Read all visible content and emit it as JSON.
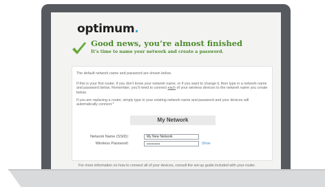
{
  "brand": {
    "name": "optimum",
    "dot": ".",
    "dot_color": "#3fa4d8"
  },
  "header": {
    "headline": "Good news, you’re almost finished",
    "subhead": "It’s time to name your network and create a password.",
    "accent": "#4e8a2e"
  },
  "intro": {
    "p1": "The default network name and password are shown below.",
    "p2_before": "If this is your first router, if you don’t know your network name, or if you want to change it, then type in a network name and password below. Remember, you’ll need to connect ",
    "p2_underlined": "each",
    "p2_after": " of your wireless devices to the network name you create below.",
    "p3": "If you are replacing a router, simply type in your existing network name and password and your devices will automatically connect.*"
  },
  "network_form": {
    "title": "My Network",
    "ssid_label": "Network Name (SSID):",
    "ssid_value": "My New Network",
    "password_label": "Wireless Password:",
    "password_value": "••••••••••",
    "show_label": "Show"
  },
  "footer": {
    "note": "For more information on how to connect all of your devices, consult the set-up guide included with your router."
  }
}
